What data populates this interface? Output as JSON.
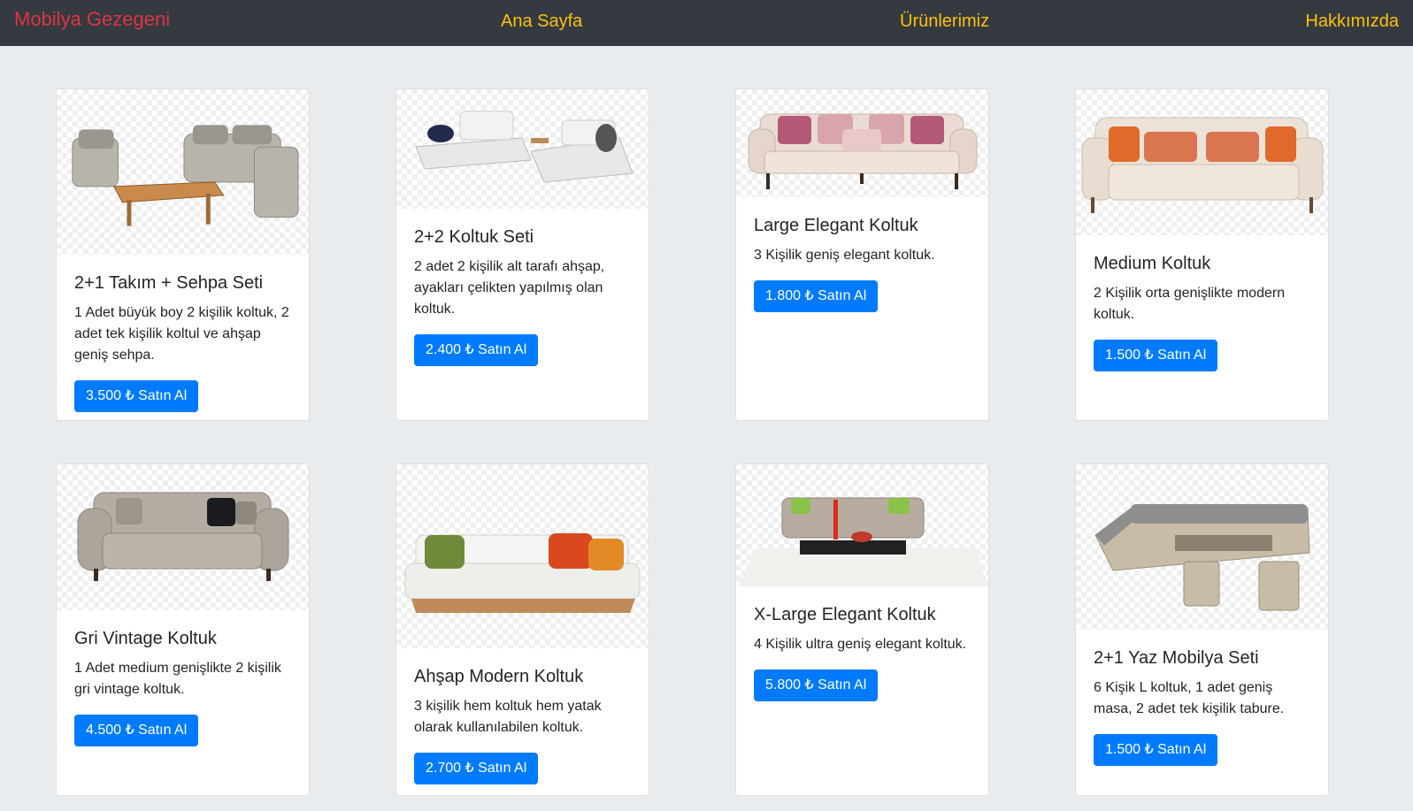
{
  "navbar": {
    "brand": "Mobilya Gezegeni",
    "links": [
      "Ana Sayfa",
      "Ürünlerimiz",
      "Hakkımızda"
    ]
  },
  "colors": {
    "navbar_bg": "#343a40",
    "brand": "#dc3545",
    "nav_link": "#ffc107",
    "button": "#007bff",
    "page_bg": "#e9ecef"
  },
  "products": [
    {
      "title": "2+1 Takım + Sehpa Seti",
      "description": "1 Adet büyük boy 2 kişilik koltuk, 2 adet tek kişilik koltul ve ahşap geniş sehpa.",
      "price": "3.500 ₺",
      "button_label": "Satın Al",
      "image": "wicker-sofa-set-with-table-image"
    },
    {
      "title": "2+2 Koltuk Seti",
      "description": "2 adet 2 kişilik alt tarafı ahşap, ayakları çelikten yapılmış olan koltuk.",
      "price": "2.400 ₺",
      "button_label": "Satın Al",
      "image": "white-modular-sofa-set-image"
    },
    {
      "title": "Large Elegant Koltuk",
      "description": "3 Kişilik geniş elegant koltuk.",
      "price": "1.800 ₺",
      "button_label": "Satın Al",
      "image": "cream-elegant-sofa-image"
    },
    {
      "title": "Medium Koltuk",
      "description": "2 Kişilik orta genişlikte modern koltuk.",
      "price": "1.500 ₺",
      "button_label": "Satın Al",
      "image": "beige-sofa-orange-cushions-image"
    },
    {
      "title": "Gri Vintage Koltuk",
      "description": "1 Adet medium genişlikte 2 kişilik gri vintage koltuk.",
      "price": "4.500 ₺",
      "button_label": "Satın Al",
      "image": "grey-vintage-sofa-image"
    },
    {
      "title": "Ahşap Modern Koltuk",
      "description": "3 kişilik hem koltuk hem yatak olarak kullanılabilen koltuk.",
      "price": "2.700 ₺",
      "button_label": "Satın Al",
      "image": "white-sofa-wooden-base-image"
    },
    {
      "title": "X-Large Elegant Koltuk",
      "description": "4 Kişilik ultra geniş elegant koltuk.",
      "price": "5.800 ₺",
      "button_label": "Satın Al",
      "image": "grey-sofa-with-rug-and-table-image"
    },
    {
      "title": "2+1 Yaz Mobilya Seti",
      "description": "6 Kişik L koltuk, 1 adet geniş masa, 2 adet tek kişilik tabure.",
      "price": "1.500 ₺",
      "button_label": "Satın Al",
      "image": "wicker-l-sofa-dining-set-image"
    }
  ]
}
